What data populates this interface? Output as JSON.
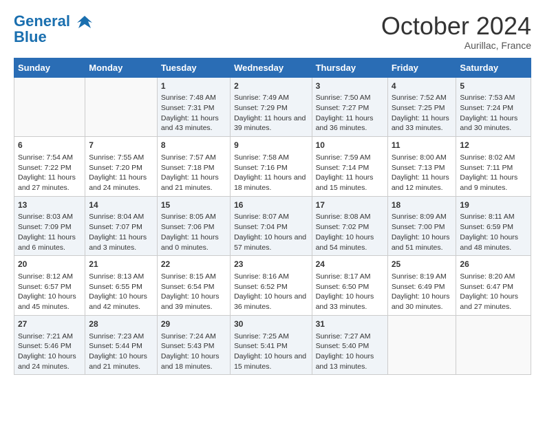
{
  "header": {
    "logo_line1": "General",
    "logo_line2": "Blue",
    "month": "October 2024",
    "location": "Aurillac, France"
  },
  "days_of_week": [
    "Sunday",
    "Monday",
    "Tuesday",
    "Wednesday",
    "Thursday",
    "Friday",
    "Saturday"
  ],
  "weeks": [
    [
      {
        "day": "",
        "content": ""
      },
      {
        "day": "",
        "content": ""
      },
      {
        "day": "1",
        "content": "Sunrise: 7:48 AM\nSunset: 7:31 PM\nDaylight: 11 hours and 43 minutes."
      },
      {
        "day": "2",
        "content": "Sunrise: 7:49 AM\nSunset: 7:29 PM\nDaylight: 11 hours and 39 minutes."
      },
      {
        "day": "3",
        "content": "Sunrise: 7:50 AM\nSunset: 7:27 PM\nDaylight: 11 hours and 36 minutes."
      },
      {
        "day": "4",
        "content": "Sunrise: 7:52 AM\nSunset: 7:25 PM\nDaylight: 11 hours and 33 minutes."
      },
      {
        "day": "5",
        "content": "Sunrise: 7:53 AM\nSunset: 7:24 PM\nDaylight: 11 hours and 30 minutes."
      }
    ],
    [
      {
        "day": "6",
        "content": "Sunrise: 7:54 AM\nSunset: 7:22 PM\nDaylight: 11 hours and 27 minutes."
      },
      {
        "day": "7",
        "content": "Sunrise: 7:55 AM\nSunset: 7:20 PM\nDaylight: 11 hours and 24 minutes."
      },
      {
        "day": "8",
        "content": "Sunrise: 7:57 AM\nSunset: 7:18 PM\nDaylight: 11 hours and 21 minutes."
      },
      {
        "day": "9",
        "content": "Sunrise: 7:58 AM\nSunset: 7:16 PM\nDaylight: 11 hours and 18 minutes."
      },
      {
        "day": "10",
        "content": "Sunrise: 7:59 AM\nSunset: 7:14 PM\nDaylight: 11 hours and 15 minutes."
      },
      {
        "day": "11",
        "content": "Sunrise: 8:00 AM\nSunset: 7:13 PM\nDaylight: 11 hours and 12 minutes."
      },
      {
        "day": "12",
        "content": "Sunrise: 8:02 AM\nSunset: 7:11 PM\nDaylight: 11 hours and 9 minutes."
      }
    ],
    [
      {
        "day": "13",
        "content": "Sunrise: 8:03 AM\nSunset: 7:09 PM\nDaylight: 11 hours and 6 minutes."
      },
      {
        "day": "14",
        "content": "Sunrise: 8:04 AM\nSunset: 7:07 PM\nDaylight: 11 hours and 3 minutes."
      },
      {
        "day": "15",
        "content": "Sunrise: 8:05 AM\nSunset: 7:06 PM\nDaylight: 11 hours and 0 minutes."
      },
      {
        "day": "16",
        "content": "Sunrise: 8:07 AM\nSunset: 7:04 PM\nDaylight: 10 hours and 57 minutes."
      },
      {
        "day": "17",
        "content": "Sunrise: 8:08 AM\nSunset: 7:02 PM\nDaylight: 10 hours and 54 minutes."
      },
      {
        "day": "18",
        "content": "Sunrise: 8:09 AM\nSunset: 7:00 PM\nDaylight: 10 hours and 51 minutes."
      },
      {
        "day": "19",
        "content": "Sunrise: 8:11 AM\nSunset: 6:59 PM\nDaylight: 10 hours and 48 minutes."
      }
    ],
    [
      {
        "day": "20",
        "content": "Sunrise: 8:12 AM\nSunset: 6:57 PM\nDaylight: 10 hours and 45 minutes."
      },
      {
        "day": "21",
        "content": "Sunrise: 8:13 AM\nSunset: 6:55 PM\nDaylight: 10 hours and 42 minutes."
      },
      {
        "day": "22",
        "content": "Sunrise: 8:15 AM\nSunset: 6:54 PM\nDaylight: 10 hours and 39 minutes."
      },
      {
        "day": "23",
        "content": "Sunrise: 8:16 AM\nSunset: 6:52 PM\nDaylight: 10 hours and 36 minutes."
      },
      {
        "day": "24",
        "content": "Sunrise: 8:17 AM\nSunset: 6:50 PM\nDaylight: 10 hours and 33 minutes."
      },
      {
        "day": "25",
        "content": "Sunrise: 8:19 AM\nSunset: 6:49 PM\nDaylight: 10 hours and 30 minutes."
      },
      {
        "day": "26",
        "content": "Sunrise: 8:20 AM\nSunset: 6:47 PM\nDaylight: 10 hours and 27 minutes."
      }
    ],
    [
      {
        "day": "27",
        "content": "Sunrise: 7:21 AM\nSunset: 5:46 PM\nDaylight: 10 hours and 24 minutes."
      },
      {
        "day": "28",
        "content": "Sunrise: 7:23 AM\nSunset: 5:44 PM\nDaylight: 10 hours and 21 minutes."
      },
      {
        "day": "29",
        "content": "Sunrise: 7:24 AM\nSunset: 5:43 PM\nDaylight: 10 hours and 18 minutes."
      },
      {
        "day": "30",
        "content": "Sunrise: 7:25 AM\nSunset: 5:41 PM\nDaylight: 10 hours and 15 minutes."
      },
      {
        "day": "31",
        "content": "Sunrise: 7:27 AM\nSunset: 5:40 PM\nDaylight: 10 hours and 13 minutes."
      },
      {
        "day": "",
        "content": ""
      },
      {
        "day": "",
        "content": ""
      }
    ]
  ]
}
